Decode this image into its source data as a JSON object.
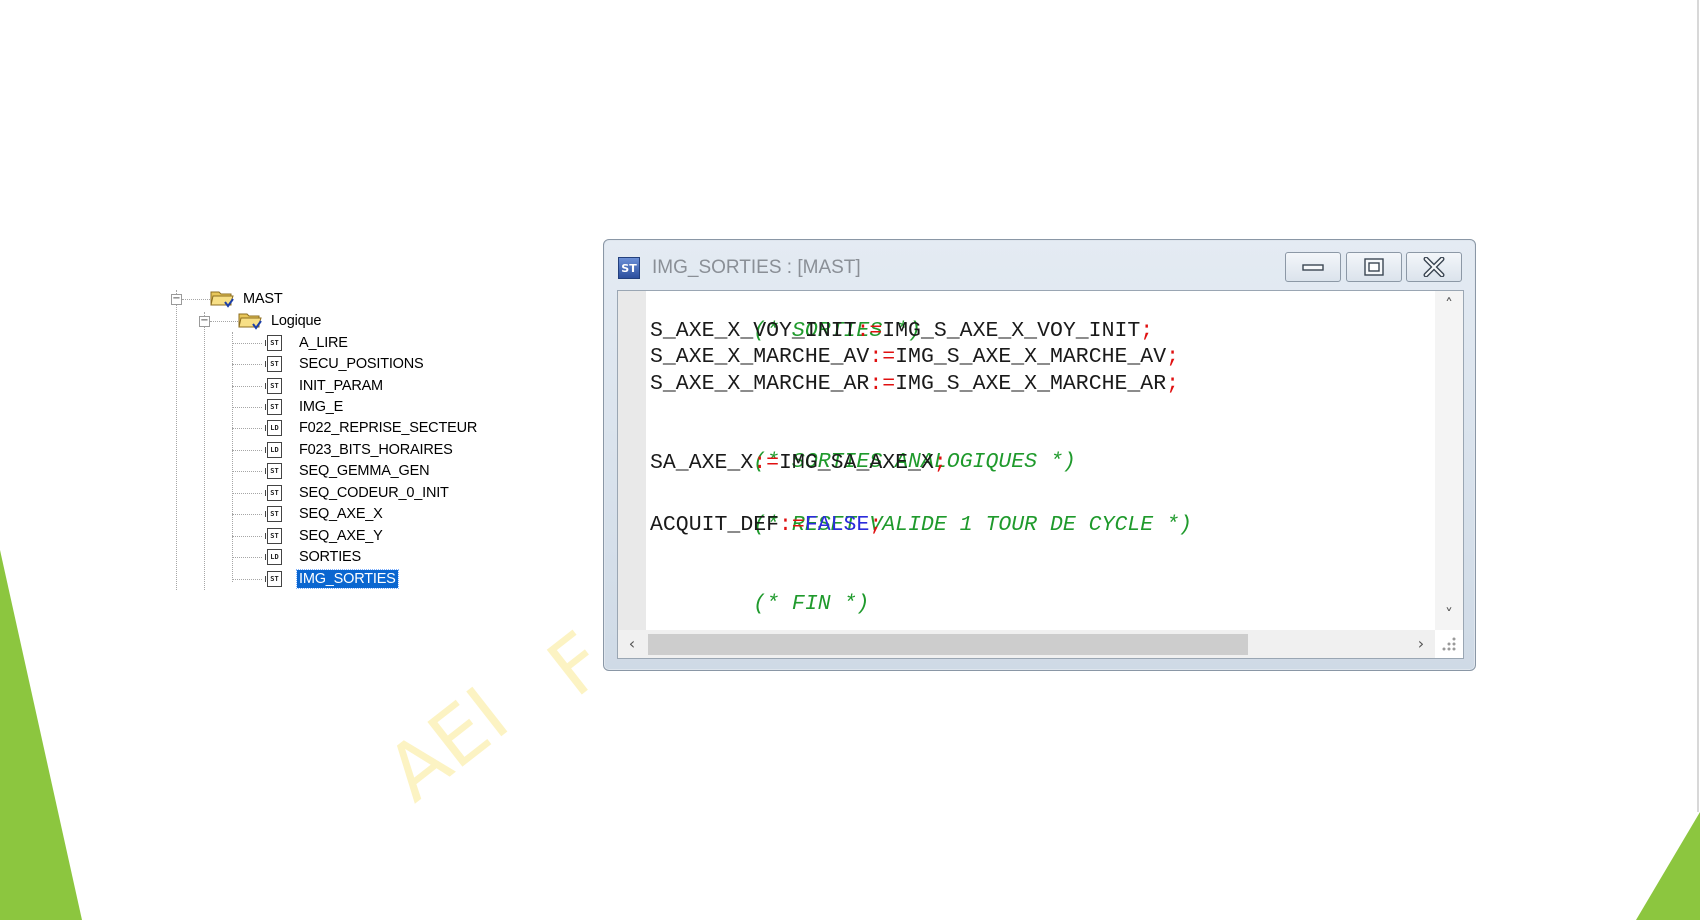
{
  "tree": {
    "root": {
      "label": "MAST",
      "icon": "folder-icon"
    },
    "folder": {
      "label": "Logique",
      "icon": "folder-icon"
    },
    "items": [
      {
        "label": "A_LIRE",
        "type": "ST",
        "selected": false
      },
      {
        "label": "SECU_POSITIONS",
        "type": "ST",
        "selected": false
      },
      {
        "label": "INIT_PARAM",
        "type": "ST",
        "selected": false
      },
      {
        "label": "IMG_E",
        "type": "ST",
        "selected": false
      },
      {
        "label": "F022_REPRISE_SECTEUR",
        "type": "LD",
        "selected": false
      },
      {
        "label": "F023_BITS_HORAIRES",
        "type": "LD",
        "selected": false
      },
      {
        "label": "SEQ_GEMMA_GEN",
        "type": "ST",
        "selected": false
      },
      {
        "label": "SEQ_CODEUR_0_INIT",
        "type": "ST",
        "selected": false
      },
      {
        "label": "SEQ_AXE_X",
        "type": "ST",
        "selected": false
      },
      {
        "label": "SEQ_AXE_Y",
        "type": "ST",
        "selected": false
      },
      {
        "label": "SORTIES",
        "type": "LD",
        "selected": false
      },
      {
        "label": "IMG_SORTIES",
        "type": "ST",
        "selected": true
      }
    ]
  },
  "window": {
    "title": "IMG_SORTIES : [MAST]",
    "app_icon_text": "ST",
    "buttons": [
      "minimize",
      "maximize",
      "close"
    ]
  },
  "code": {
    "c1": "(* SORTIES *)",
    "l1a": "S_AXE_X_VOY_INIT",
    "l1op": ":=",
    "l1b": "IMG_S_AXE_X_VOY_INIT",
    "l1end": ";",
    "l2a": "S_AXE_X_MARCHE_AV",
    "l2op": ":=",
    "l2b": "IMG_S_AXE_X_MARCHE_AV",
    "l2end": ";",
    "l3a": "S_AXE_X_MARCHE_AR",
    "l3op": ":=",
    "l3b": "IMG_S_AXE_X_MARCHE_AR",
    "l3end": ";",
    "c2": "(* SORTIES ANALOGIQUES *)",
    "l4a": "SA_AXE_X",
    "l4op": ":=",
    "l4b": "IMG_SA_AXE_X",
    "l4end": ";",
    "c3": "(* RESET VALIDE 1 TOUR DE CYCLE *)",
    "l5a": "ACQUIT_DEF",
    "l5op": ":=",
    "l5b": "FALSE",
    "l5end": ";",
    "c4": "(* FIN *)"
  },
  "watermark": {
    "w1": "AEI",
    "w2": "F"
  },
  "colors": {
    "comment": "#1f9a2c",
    "operator": "#e01010",
    "keyword": "#2b2bdb",
    "selection": "#0a66d0",
    "accent_green": "#8cc63f"
  }
}
